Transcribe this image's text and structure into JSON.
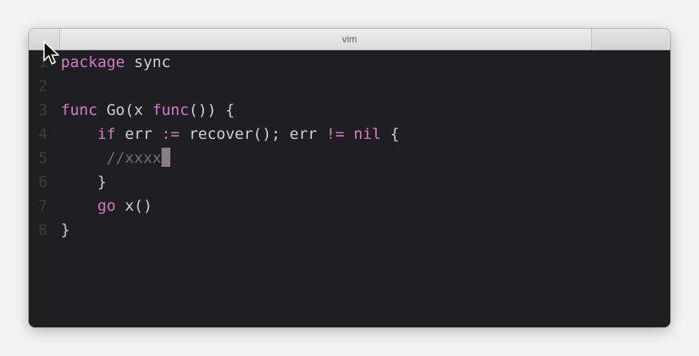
{
  "window": {
    "title": "vim"
  },
  "editor": {
    "lines": [
      {
        "num": "1",
        "tokens": [
          {
            "t": "package",
            "k": "kw"
          },
          {
            "t": " sync",
            "k": "plain"
          }
        ]
      },
      {
        "num": "2",
        "tokens": []
      },
      {
        "num": "3",
        "tokens": [
          {
            "t": "func",
            "k": "kw"
          },
          {
            "t": " Go(x ",
            "k": "plain"
          },
          {
            "t": "func",
            "k": "kw"
          },
          {
            "t": "()) {",
            "k": "plain"
          }
        ]
      },
      {
        "num": "4",
        "tokens": [
          {
            "t": "    ",
            "k": "plain"
          },
          {
            "t": "if",
            "k": "kw"
          },
          {
            "t": " err ",
            "k": "plain"
          },
          {
            "t": ":=",
            "k": "kw"
          },
          {
            "t": " recover(); err ",
            "k": "plain"
          },
          {
            "t": "!=",
            "k": "kw"
          },
          {
            "t": " ",
            "k": "plain"
          },
          {
            "t": "nil",
            "k": "kw"
          },
          {
            "t": " {",
            "k": "plain"
          }
        ]
      },
      {
        "num": "5",
        "tokens": [
          {
            "t": "     //xxxx",
            "k": "cmt"
          }
        ],
        "cursor": true
      },
      {
        "num": "6",
        "tokens": [
          {
            "t": "    }",
            "k": "plain"
          }
        ]
      },
      {
        "num": "7",
        "tokens": [
          {
            "t": "    ",
            "k": "plain"
          },
          {
            "t": "go",
            "k": "kw"
          },
          {
            "t": " x()",
            "k": "plain"
          }
        ]
      },
      {
        "num": "8",
        "tokens": [
          {
            "t": "}",
            "k": "plain"
          }
        ]
      }
    ]
  },
  "colors": {
    "keyword": "#d37ad0",
    "text": "#cfcfd4",
    "comment": "#6e6e74",
    "background": "#1f1f21"
  },
  "icons": {
    "pointer": "mouse-pointer-icon"
  }
}
